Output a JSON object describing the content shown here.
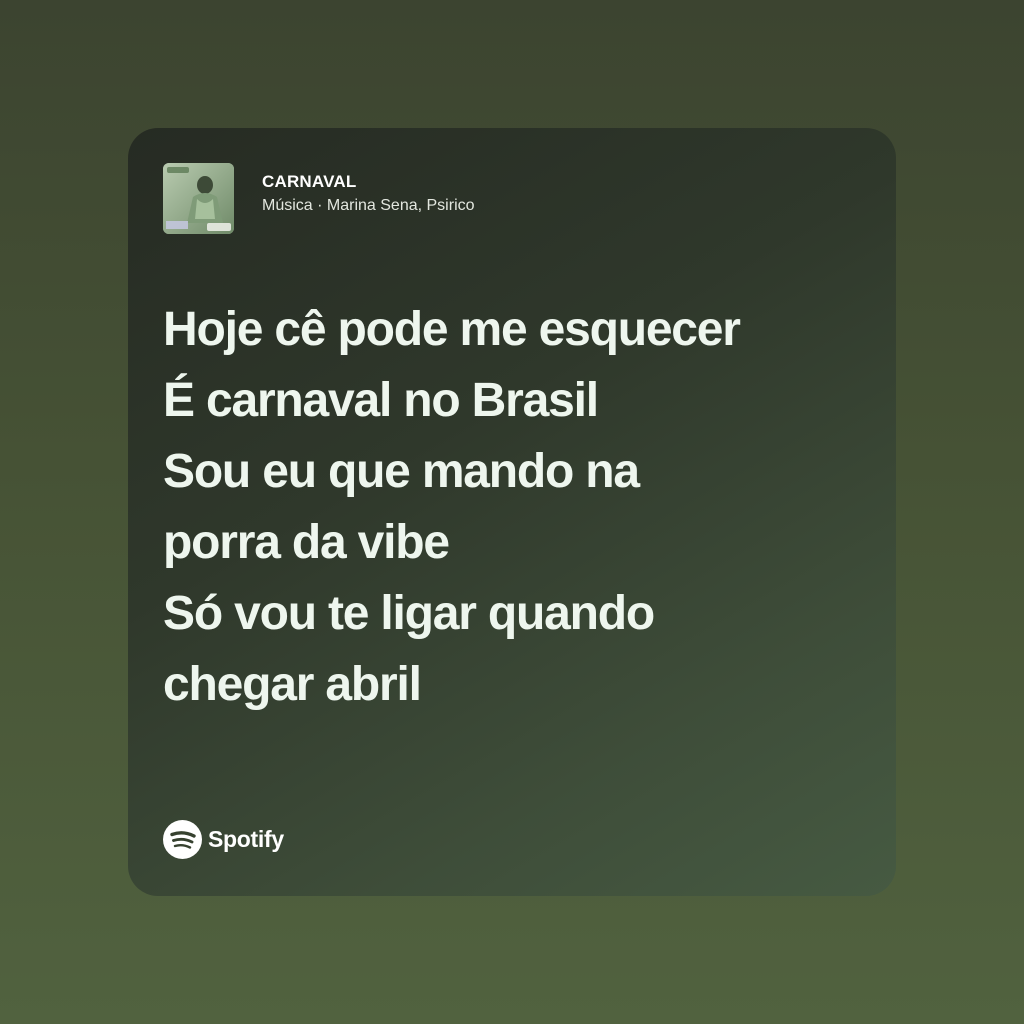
{
  "track": {
    "title": "CARNAVAL",
    "subtitle": "Música · Marina Sena, Psirico",
    "cover_label": "Psirico"
  },
  "lyrics": {
    "lines": [
      "Hoje cê pode me esquecer",
      "É carnaval no Brasil",
      "Sou eu que mando na",
      "porra da vibe",
      "Só vou te ligar quando",
      "chegar abril"
    ]
  },
  "brand": {
    "name": "Spotify",
    "icon": "spotify-logo-icon"
  },
  "colors": {
    "background": "#465235",
    "card": "#2f382b",
    "lyric_text": "#eef6ee",
    "meta_text": "#e3e7df"
  }
}
